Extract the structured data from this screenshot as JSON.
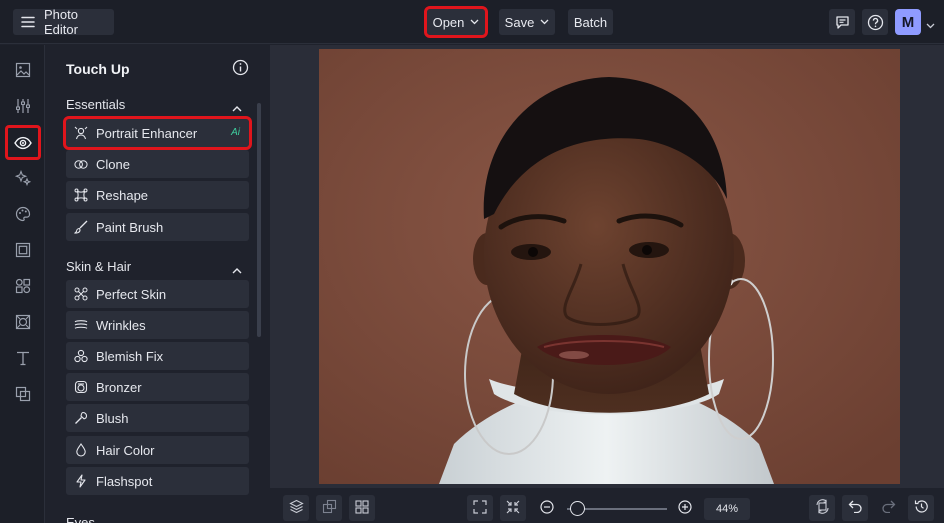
{
  "app": {
    "title": "Photo Editor"
  },
  "toolbar": {
    "open_label": "Open",
    "save_label": "Save",
    "batch_label": "Batch"
  },
  "user": {
    "initial": "M"
  },
  "panel": {
    "title": "Touch Up",
    "sections": [
      {
        "label": "Essentials",
        "tools": [
          {
            "label": "Portrait Enhancer",
            "badge": "Ai"
          },
          {
            "label": "Clone"
          },
          {
            "label": "Reshape"
          },
          {
            "label": "Paint Brush"
          }
        ]
      },
      {
        "label": "Skin & Hair",
        "tools": [
          {
            "label": "Perfect Skin"
          },
          {
            "label": "Wrinkles"
          },
          {
            "label": "Blemish Fix"
          },
          {
            "label": "Bronzer"
          },
          {
            "label": "Blush"
          },
          {
            "label": "Hair Color"
          },
          {
            "label": "Flashspot"
          }
        ]
      },
      {
        "label": "Eyes"
      }
    ]
  },
  "zoom": {
    "value": "44%",
    "level": 0.1
  },
  "colors": {
    "accent_highlight": "#e0151c",
    "avatar": "#8f9bff",
    "ai_badge": "#3fd0a0",
    "background": "#1f222c"
  }
}
